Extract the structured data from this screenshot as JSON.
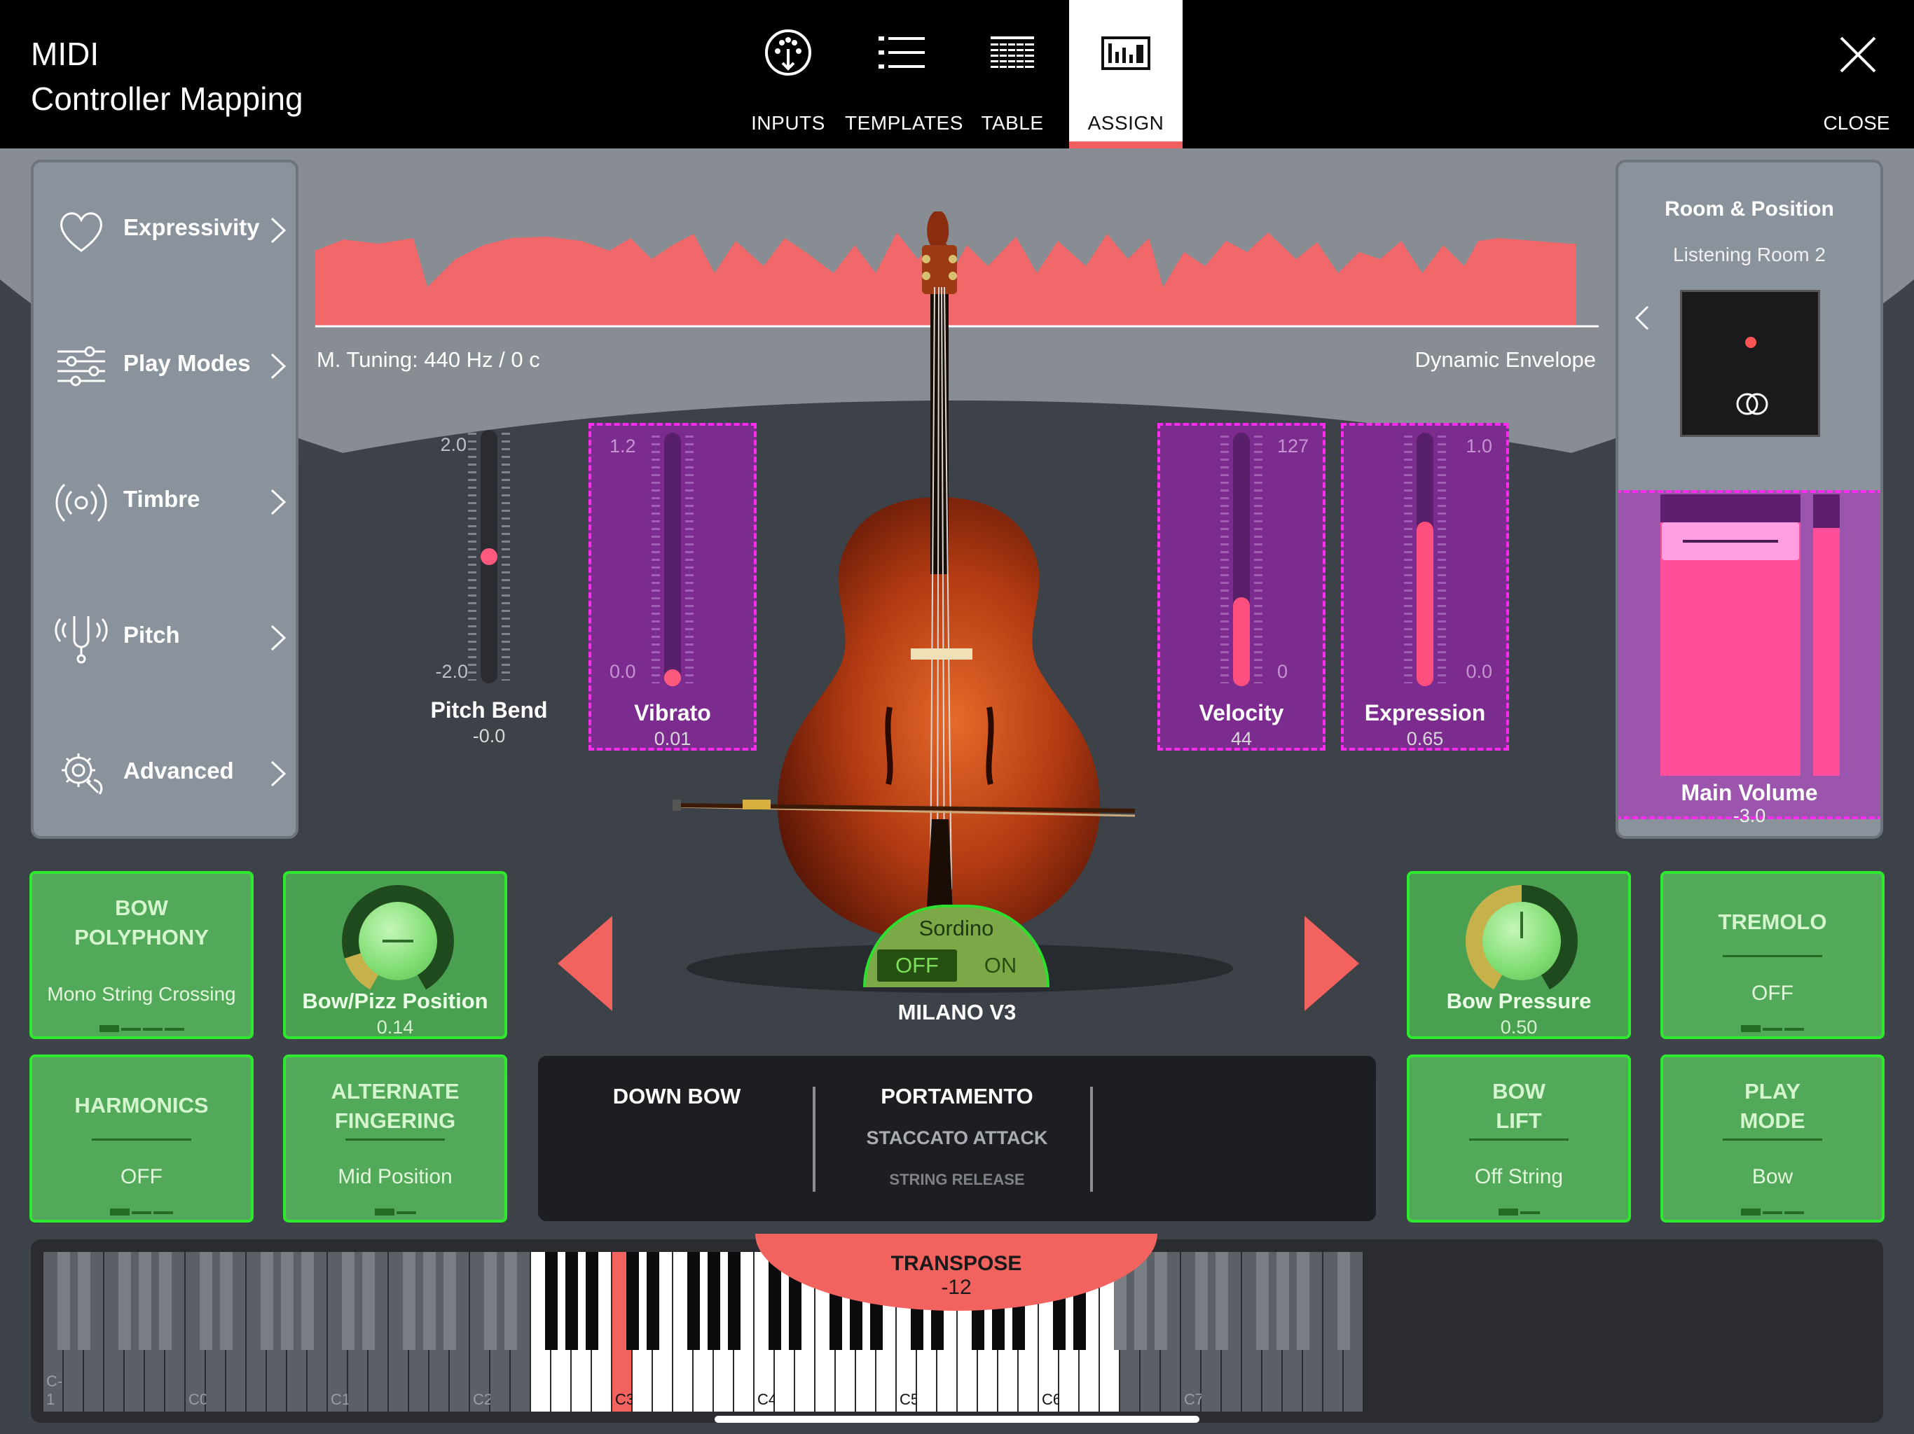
{
  "header": {
    "title_line1": "MIDI",
    "title_line2": "Controller Mapping",
    "tabs": [
      {
        "label": "INPUTS",
        "icon": "midi-port-icon"
      },
      {
        "label": "TEMPLATES",
        "icon": "list-icon"
      },
      {
        "label": "TABLE",
        "icon": "table-grid-icon"
      },
      {
        "label": "ASSIGN",
        "icon": "mixer-icon"
      }
    ],
    "active_tab": "ASSIGN",
    "close_label": "CLOSE"
  },
  "sidebar": {
    "items": [
      {
        "label": "Expressivity",
        "icon": "heart-icon"
      },
      {
        "label": "Play Modes",
        "icon": "sliders-icon"
      },
      {
        "label": "Timbre",
        "icon": "radio-waves-icon"
      },
      {
        "label": "Pitch",
        "icon": "tuning-fork-icon"
      },
      {
        "label": "Advanced",
        "icon": "gear-brain-icon"
      }
    ]
  },
  "envelope": {
    "tuning": "M. Tuning: 440 Hz / 0 c",
    "label": "Dynamic Envelope"
  },
  "sliders": [
    {
      "name": "Pitch Bend",
      "value": "-0.0",
      "max": "2.0",
      "min": "-2.0",
      "position": 0.5,
      "mapped": false
    },
    {
      "name": "Vibrato",
      "value": "0.01",
      "max": "1.2",
      "min": "0.0",
      "position": 0.0,
      "mapped": true
    },
    {
      "name": "Velocity",
      "value": "44",
      "max": "127",
      "min": "0",
      "position": 0.35,
      "mapped": true
    },
    {
      "name": "Expression",
      "value": "0.65",
      "max": "1.0",
      "min": "0.0",
      "position": 0.65,
      "mapped": true
    }
  ],
  "room": {
    "title": "Room & Position",
    "subtitle": "Listening Room 2"
  },
  "main_volume": {
    "name": "Main Volume",
    "value": "-3.0",
    "level": 0.9,
    "meter_level": 0.88
  },
  "instrument": {
    "name": "MILANO V3"
  },
  "sordino": {
    "title": "Sordino",
    "off_label": "OFF",
    "on_label": "ON",
    "selected": "OFF"
  },
  "left_controls": {
    "bow_polyphony": {
      "title_line1": "BOW",
      "title_line2": "POLYPHONY",
      "value": "Mono String Crossing",
      "step": 0,
      "steps": 4
    },
    "bow_pizz": {
      "name": "Bow/Pizz Position",
      "value": "0.14",
      "level": 0.14
    },
    "harmonics": {
      "title": "HARMONICS",
      "value": "OFF",
      "step": 0,
      "steps": 3
    },
    "alternate_fingering": {
      "title_line1": "ALTERNATE",
      "title_line2": "FINGERING",
      "value": "Mid Position",
      "step": 0,
      "steps": 2
    }
  },
  "right_controls": {
    "bow_pressure": {
      "name": "Bow Pressure",
      "value": "0.50",
      "level": 0.5
    },
    "tremolo": {
      "title": "TREMOLO",
      "value": "OFF",
      "step": 0,
      "steps": 3
    },
    "bow_lift": {
      "title_line1": "BOW",
      "title_line2": "LIFT",
      "value": "Off String",
      "step": 0,
      "steps": 2
    },
    "play_mode": {
      "title_line1": "PLAY",
      "title_line2": "MODE",
      "value": "Bow",
      "step": 0,
      "steps": 3
    }
  },
  "articulations": [
    {
      "primary": "DOWN BOW",
      "secondary": "",
      "tertiary": ""
    },
    {
      "primary": "PORTAMENTO",
      "secondary": "STACCATO ATTACK",
      "tertiary": "STRING RELEASE"
    },
    {
      "primary": "",
      "secondary": "",
      "tertiary": ""
    }
  ],
  "keyboard": {
    "octave_labels": [
      "C-1",
      "C0",
      "C1",
      "C2",
      "C3",
      "C4",
      "C5",
      "C6",
      "C7"
    ],
    "transpose_label": "TRANSPOSE",
    "transpose_value": "-12",
    "highlight_key": "C3"
  },
  "colors": {
    "accent_red": "#f2635f",
    "mapped_magenta": "#ff2cf0",
    "mapped_fill": "#7c2c8f",
    "control_green": "#52a95a",
    "control_border": "#2eea2e",
    "value_pink": "#ff4f7f"
  }
}
